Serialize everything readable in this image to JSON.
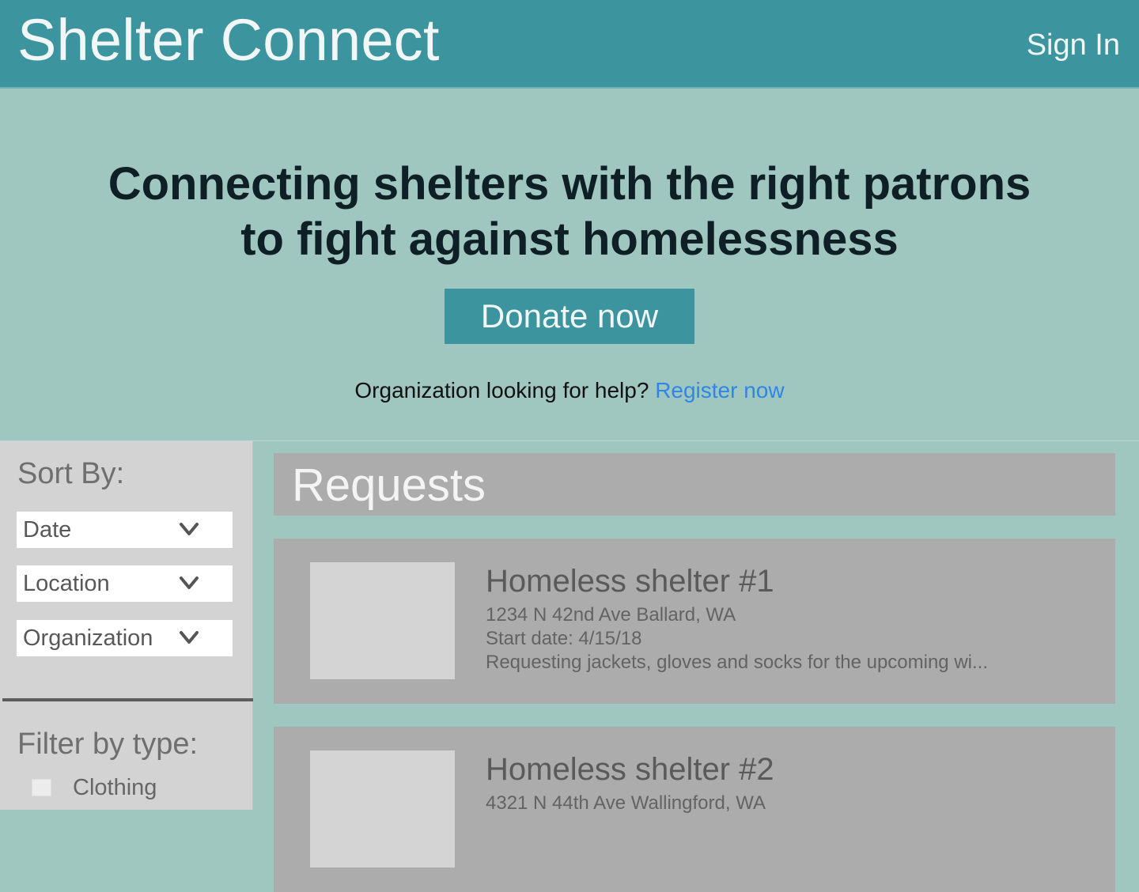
{
  "header": {
    "brand": "Shelter Connect",
    "sign_in": "Sign In"
  },
  "hero": {
    "title_line1": "Connecting shelters with the right patrons",
    "title_line2": "to fight against homelessness",
    "donate_label": "Donate now",
    "org_question": "Organization looking for help?",
    "register_label": "Register now"
  },
  "sidebar": {
    "sort_label": "Sort By:",
    "sort_options": [
      {
        "label": "Date"
      },
      {
        "label": "Location"
      },
      {
        "label": "Organization"
      }
    ],
    "filter_label": "Filter by type:",
    "filters": [
      {
        "label": "Clothing",
        "checked": false
      }
    ]
  },
  "main": {
    "requests_title": "Requests",
    "requests": [
      {
        "title": "Homeless shelter #1",
        "address": "1234 N 42nd Ave Ballard, WA",
        "start_date": "Start date: 4/15/18",
        "description": "Requesting jackets, gloves and socks for the upcoming wi..."
      },
      {
        "title": "Homeless shelter #2",
        "address": "4321 N 44th Ave Wallingford, WA"
      }
    ]
  },
  "colors": {
    "header_bg": "#3c959e",
    "hero_bg": "#9fc6bf",
    "link": "#2f86e8",
    "card_bg": "#acacac",
    "sidebar_bg": "#d3d3d3"
  },
  "icons": {
    "dropdown": "chevron-down-icon",
    "checkbox": "checkbox-icon",
    "thumbnail": "image-placeholder"
  }
}
